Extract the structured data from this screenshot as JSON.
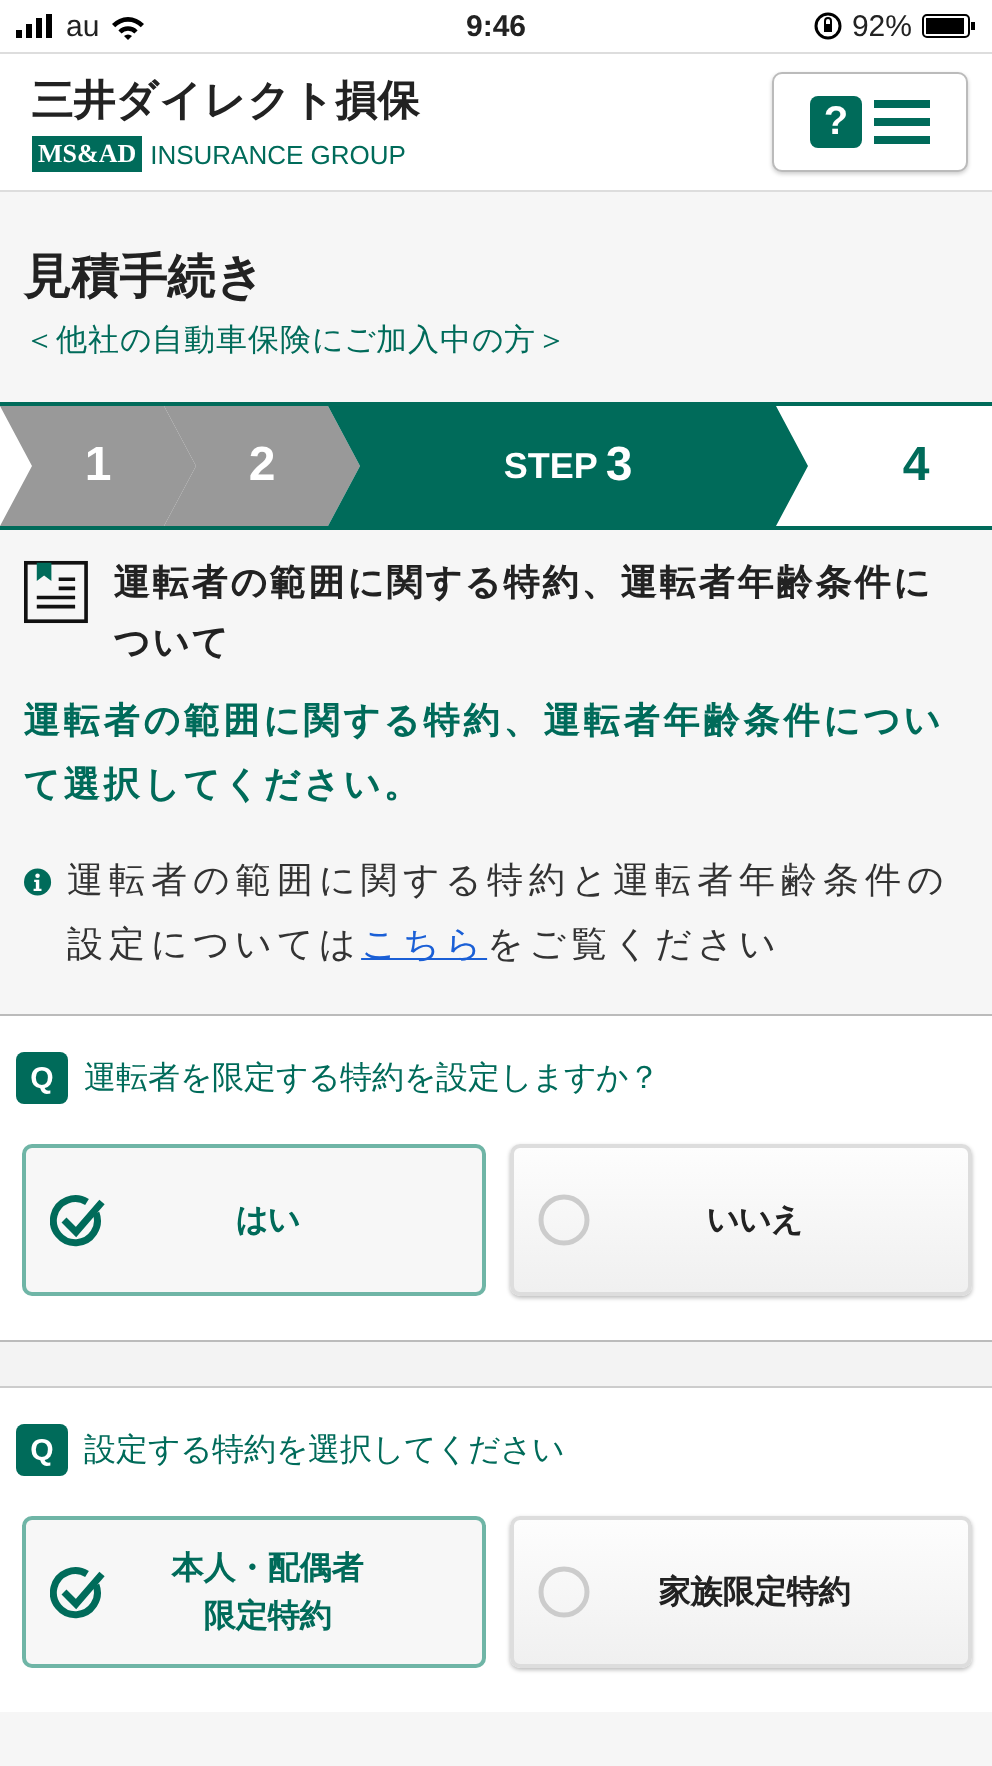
{
  "status_bar": {
    "carrier": "au",
    "time": "9:46",
    "battery": "92%"
  },
  "header": {
    "brand": "三井ダイレクト損保",
    "group_badge": "MS&AD",
    "group_name": "INSURANCE GROUP",
    "help_mark": "?"
  },
  "page": {
    "title": "見積手続き",
    "subtitle": "＜他社の自動車保険にご加入中の方＞"
  },
  "steps": [
    {
      "number": "1",
      "kind": "done"
    },
    {
      "number": "2",
      "kind": "done"
    },
    {
      "prefix": "STEP",
      "number": "3",
      "kind": "current"
    },
    {
      "number": "4",
      "kind": "upcoming"
    }
  ],
  "section": {
    "heading": "運転者の範囲に関する特約、運転者年齢条件について",
    "lead": "運転者の範囲に関する特約、運転者年齢条件について選択してください。",
    "info_before": "運転者の範囲に関する特約と運転者年齢条件の設定については",
    "info_link": "こちら",
    "info_after": "をご覧ください"
  },
  "questions": [
    {
      "mark": "Q",
      "text": "運転者を限定する特約を設定しますか？",
      "options": [
        {
          "label": "はい",
          "selected": true
        },
        {
          "label": "いいえ",
          "selected": false
        }
      ]
    },
    {
      "mark": "Q",
      "text": "設定する特約を選択してください",
      "options": [
        {
          "label": "本人・配偶者限定特約",
          "selected": true
        },
        {
          "label": "家族限定特約",
          "selected": false
        }
      ]
    }
  ]
}
